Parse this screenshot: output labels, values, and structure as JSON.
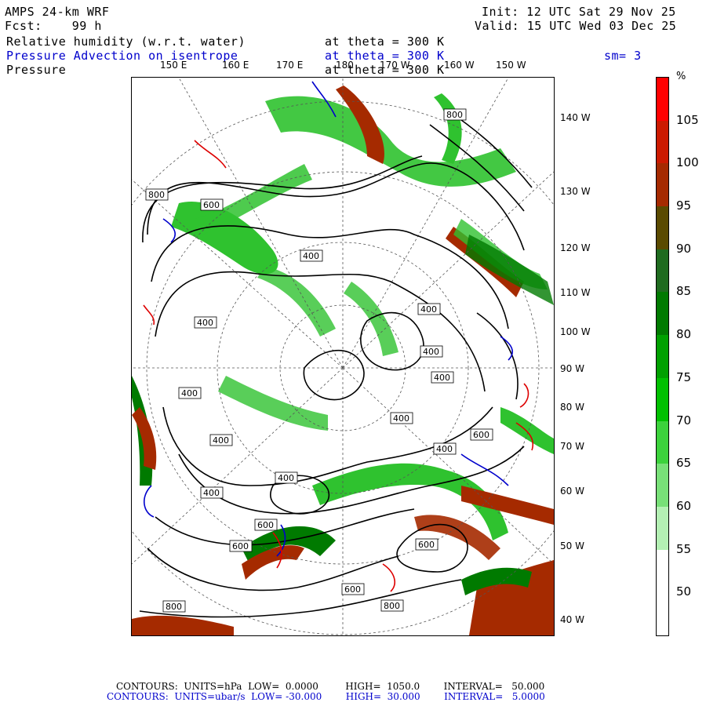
{
  "header": {
    "model": "AMPS 24-km WRF",
    "fcst_label": "Fcst:",
    "fcst_hours": "99 h",
    "init": "Init: 12 UTC Sat 29 Nov 25",
    "valid": "Valid: 15 UTC Wed 03 Dec 25",
    "fields": [
      {
        "name": "Relative humidity (w.r.t. water)",
        "level": "at theta = 300 K",
        "color": "#000000"
      },
      {
        "name": "Pressure Advection on isentrope",
        "level": "at theta = 300 K",
        "color": "#0000cc"
      },
      {
        "name": "Pressure",
        "level": "at theta = 300 K",
        "color": "#000000"
      }
    ],
    "smoothing": "sm= 3"
  },
  "map": {
    "top_longitudes": [
      "150 E",
      "160 E",
      "170 E",
      "180",
      "170 W",
      "160 W",
      "150 W"
    ],
    "right_longitudes": [
      "140 W",
      "130 W",
      "120 W",
      "110 W",
      "100 W",
      "90 W",
      "80 W",
      "70 W",
      "60 W",
      "50 W",
      "40 W"
    ],
    "contour_labels": [
      "800",
      "600",
      "400",
      "400",
      "400",
      "400",
      "400",
      "400",
      "400",
      "400",
      "400",
      "400",
      "400",
      "600",
      "600",
      "600",
      "600",
      "600",
      "800",
      "800",
      "800"
    ],
    "colors": {
      "dry": "#ffffff",
      "moist": "#2fc22f",
      "wet": "#007a00",
      "sat": "#a52a00",
      "super": "#ff0000",
      "advection_neg": "#0000cc",
      "advection_pos": "#dd0000"
    }
  },
  "colorbar": {
    "unit": "%",
    "labels": [
      "105",
      "100",
      "95",
      "90",
      "85",
      "80",
      "75",
      "70",
      "65",
      "60",
      "55",
      "50"
    ],
    "colors": [
      "#ff0000",
      "#cc1a00",
      "#a52a00",
      "#5a4a00",
      "#1f6b1f",
      "#007a00",
      "#00a000",
      "#00c000",
      "#3cd23c",
      "#78e078",
      "#b4f0b4",
      "#ffffff",
      "#ffffff"
    ]
  },
  "footer": {
    "line1": "CONTOURS:  UNITS=hPa  LOW=  0.0000         HIGH=  1050.0        INTERVAL=   50.000",
    "line2": "CONTOURS:  UNITS=ubar/s  LOW= -30.000        HIGH=  30.000        INTERVAL=   5.0000"
  }
}
